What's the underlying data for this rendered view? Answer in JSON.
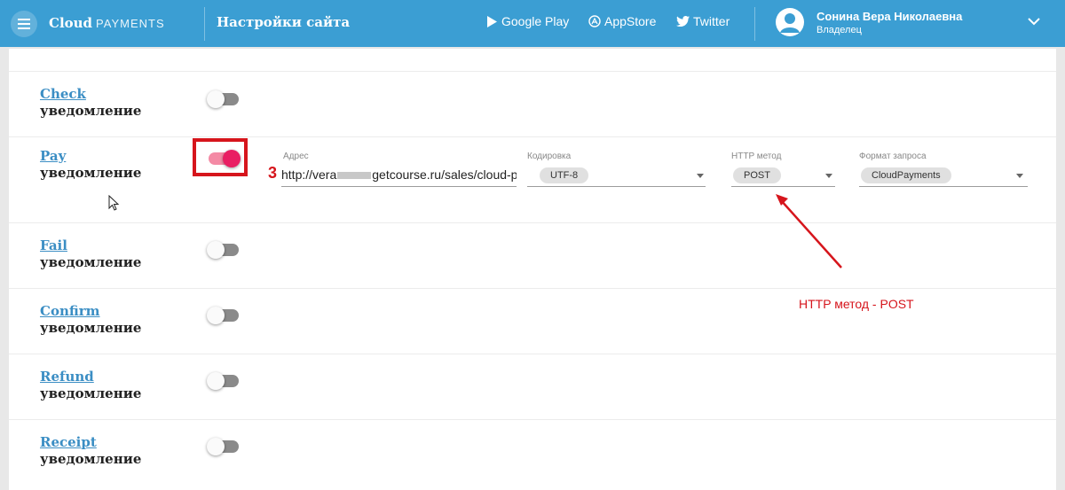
{
  "header": {
    "brand_bold": "Cloud",
    "brand_light": "PAYMENTS",
    "page_title": "Настройки сайта",
    "links": [
      {
        "label": "Google Play",
        "icon": "play-icon"
      },
      {
        "label": "AppStore",
        "icon": "appstore-icon"
      },
      {
        "label": "Twitter",
        "icon": "twitter-icon"
      }
    ],
    "user": {
      "name": "Сонина Вера Николаевна",
      "role": "Владелец"
    }
  },
  "notifications": [
    {
      "link": "Check",
      "sub": "уведомление",
      "enabled": false
    },
    {
      "link": "Pay",
      "sub": "уведомление",
      "enabled": true
    },
    {
      "link": "Fail",
      "sub": "уведомление",
      "enabled": false
    },
    {
      "link": "Confirm",
      "sub": "уведомление",
      "enabled": false
    },
    {
      "link": "Refund",
      "sub": "уведомление",
      "enabled": false
    },
    {
      "link": "Receipt",
      "sub": "уведомление",
      "enabled": false
    }
  ],
  "pay_settings": {
    "address_label": "Адрес",
    "address_prefix": "http://vera",
    "address_suffix": "getcourse.ru/sales/cloud-p",
    "encoding_label": "Кодировка",
    "encoding_value": "UTF-8",
    "method_label": "HTTP метод",
    "method_value": "POST",
    "format_label": "Формат запроса",
    "format_value": "CloudPayments"
  },
  "annotations": {
    "step_number": "3",
    "note": "HTTP метод - POST"
  },
  "colors": {
    "header": "#3b9ed3",
    "link": "#3b8ec4",
    "toggle_on": "#e91e63",
    "annotation": "#d6151c"
  }
}
